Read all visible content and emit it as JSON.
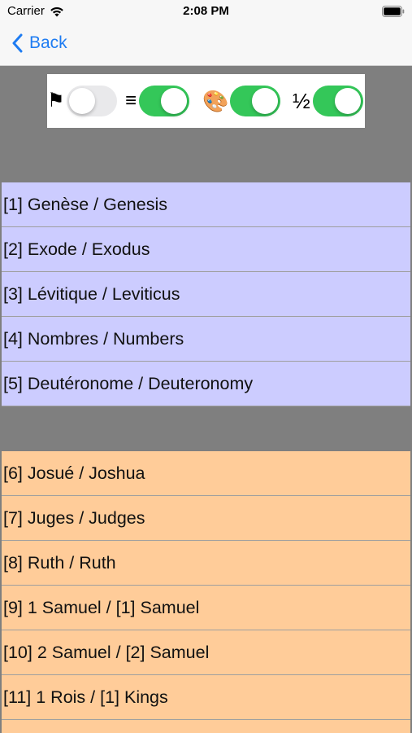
{
  "status_bar": {
    "carrier": "Carrier",
    "time": "2:08 PM",
    "wifi_icon": "wifi-icon",
    "battery_icon": "battery-icon"
  },
  "nav": {
    "back_label": "Back",
    "back_icon": "chevron-left-icon",
    "accent_color": "#1e7cf2"
  },
  "toggles": [
    {
      "symbol": "⚑",
      "icon": "flag-icon",
      "on": false
    },
    {
      "symbol": "≡",
      "icon": "menu-lines-icon",
      "on": true
    },
    {
      "symbol": "🎨",
      "icon": "palette-icon",
      "on": true
    },
    {
      "symbol": "½",
      "icon": "one-half-icon",
      "on": true
    }
  ],
  "sections": [
    {
      "color": "#ccccff",
      "books": [
        "[1] Genèse / Genesis",
        "[2] Exode / Exodus",
        "[3] Lévitique / Leviticus",
        "[4] Nombres / Numbers",
        "[5] Deutéronome / Deuteronomy"
      ]
    },
    {
      "color": "#ffcc99",
      "books": [
        "[6] Josué / Joshua",
        "[7] Juges / Judges",
        "[8] Ruth / Ruth",
        "[9] 1 Samuel / [1] Samuel",
        "[10] 2 Samuel / [2] Samuel",
        "[11] 1 Rois / [1] Kings",
        ""
      ]
    }
  ],
  "colors": {
    "background": "#7f7f7f",
    "toggle_on": "#34c759",
    "toggle_off": "#e9e9eb"
  }
}
